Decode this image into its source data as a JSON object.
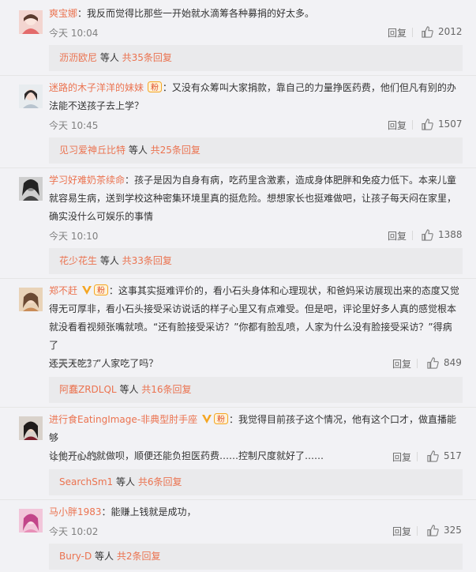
{
  "comments": [
    {
      "username": "爽宝娜",
      "text": "：我反而觉得比那些一开始就水滴筹各种募捐的好太多。",
      "time": "今天 10:04",
      "reply_label": "回复",
      "likes": "2012",
      "sub_user": "沥沥欧尼",
      "sub_mid": " 等人 ",
      "sub_total": "共35条回复"
    },
    {
      "username": "迷路的木子洋洋的妹妹",
      "text_lines": [
        "：又没有众筹叫大家捐款，靠自己的力量挣医药费，他们但凡有别的办",
        "法能不送孩子去上学？"
      ],
      "time": "今天 10:45",
      "reply_label": "回复",
      "likes": "1507",
      "sub_user": "见习爱神丘比特",
      "sub_mid": " 等人 ",
      "sub_total": "共25条回复"
    },
    {
      "username": "学习好难奶茶续命",
      "text_lines": [
        "：孩子是因为自身有病，吃药里含激素，造成身体肥胖和免疫力低下。本来儿童",
        "就容易生病，送到学校这种密集环境里真的挺危险。想想家长也挺难做吧，让孩子每天闷在家里，",
        "确实没什么可娱乐的事情"
      ],
      "time": "今天 10:10",
      "reply_label": "回复",
      "likes": "1388",
      "sub_user": "花少花生",
      "sub_mid": " 等人 ",
      "sub_total": "共33条回复"
    },
    {
      "username": "郑不赶",
      "text_lines": [
        "：这事其实挺难评价的，看小石头身体和心理现状，和爸妈采访展现出来的态度又觉",
        "得无可厚非，看小石头接受采访说话的样子心里又有点难受。但是吧，评论里好多人真的感觉根本",
        "就没看看视频张嘴就喷。“还有脸接受采访？”你都有脸乱喷，人家为什么没有脸接受采访？”得病了",
        "还天天吃？”人家吃了吗？"
      ],
      "time": "今天 10:37",
      "reply_label": "回复",
      "likes": "849",
      "sub_user": "阿蠢ZRDLQL",
      "sub_mid": " 等人 ",
      "sub_total": "共16条回复"
    },
    {
      "username": "进行食EatingImage-非典型肘手座",
      "text_lines": [
        "：我觉得目前孩子这个情况，他有这个口才，做直播能够",
        "让他开心的就做呗，顺便还能负担医药费……控制尺度就好了……"
      ],
      "time": "今天 10:45",
      "reply_label": "回复",
      "likes": "517",
      "sub_user": "SearchSm1",
      "sub_mid": " 等人 ",
      "sub_total": "共6条回复"
    },
    {
      "username": "马小胖1983",
      "text": "：能赚上钱就是成功，",
      "time": "今天 10:02",
      "reply_label": "回复",
      "likes": "325",
      "sub_user": "Bury-D",
      "sub_mid": " 等人 ",
      "sub_total": "共2条回复"
    }
  ],
  "colors": {
    "username": "#eb7350",
    "background": "#f2f2f5",
    "subbar": "#eaeaec",
    "vip_badge": "#f5a623"
  },
  "icons": [
    "like-thumb-icon",
    "vip-v-icon",
    "fan-badge-icon"
  ]
}
